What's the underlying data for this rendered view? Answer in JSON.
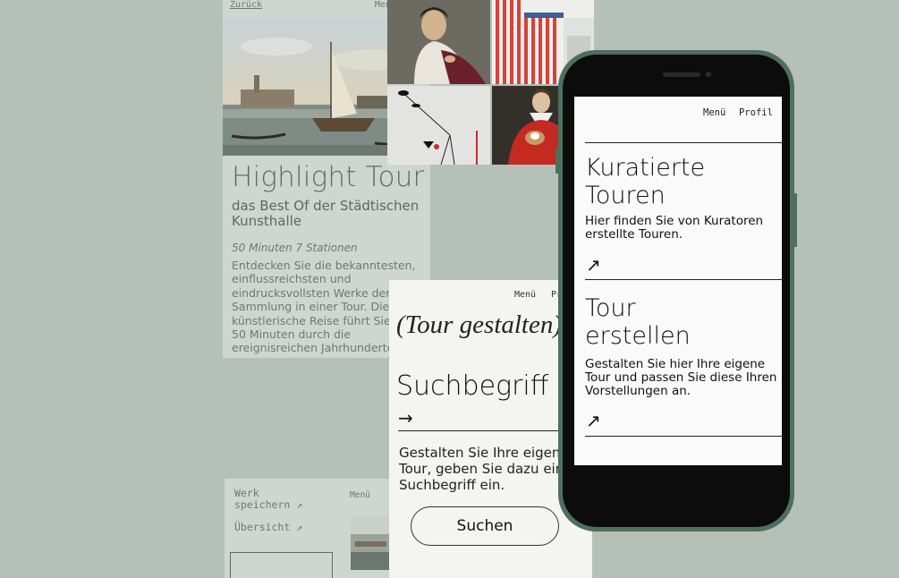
{
  "highlight_card": {
    "back_label": "Zurück",
    "menu_label": "Menü",
    "title": "Highlight Tour",
    "subtitle": "das Best Of der Städtischen Kunsthalle",
    "meta": "50 Minuten  7 Stationen",
    "description": "Entdecken Sie die bekanntesten, einflussreichsten und eindrucksvollsten Werke der Sammlung in einer Tour. Die künstlerische Reise führt Sie in 50 Minuten durch die ereignisreichen Jahrhunderte der Kunstgeschichte, von den Alten Meistern bis hin"
  },
  "art_grid": {
    "items": [
      "portrait-man-painting",
      "striped-installation",
      "mobile-sculpture",
      "portrait-woman-with-dog"
    ]
  },
  "werk_card": {
    "save_label": "Werk speichern ↗",
    "menu_label": "Menü",
    "overview_label": "Übersicht ↗"
  },
  "gestalten_card": {
    "menu_label": "Menü",
    "profile_label": "Profil",
    "heading": "(Tour gestalten)",
    "search_label": "Suchbegriff",
    "arrow": "→",
    "description": "Gestalten Sie Ihre eigene Tour, geben Sie dazu einen Suchbegriff ein.",
    "search_button": "Suchen"
  },
  "phone": {
    "menu_label": "Menü",
    "profile_label": "Profil",
    "sections": [
      {
        "title": "Kuratierte Touren",
        "text": "Hier finden Sie von Kuratoren erstellte Touren.",
        "arrow": "↗"
      },
      {
        "title": "Tour erstellen",
        "text": "Gestalten Sie hier Ihre eigene Tour und passen Sie diese Ihren Vorstellungen an.",
        "arrow": "↗"
      }
    ]
  },
  "colors": {
    "background": "#b5c0b8",
    "card": "#ced6d0",
    "phone_frame": "#4f6f5e"
  }
}
